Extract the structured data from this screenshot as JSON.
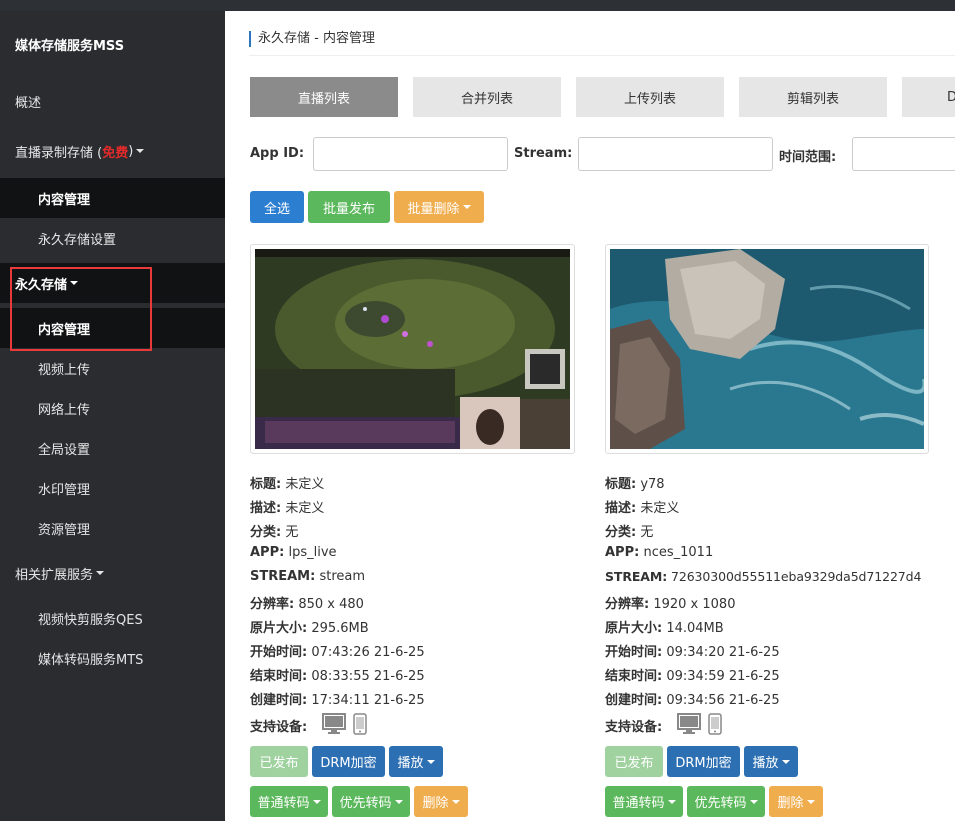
{
  "sidebar": {
    "title": "媒体存储服务MSS",
    "overview": "概述",
    "live_storage": "直播录制存储 (",
    "live_free": "免费",
    "live_close": ")",
    "content_mgmt_1": "内容管理",
    "perm_settings": "永久存储设置",
    "permanent": "永久存储",
    "content_mgmt_2": "内容管理",
    "video_upload": "视频上传",
    "net_upload": "网络上传",
    "global_settings": "全局设置",
    "watermark": "水印管理",
    "resources": "资源管理",
    "ext_services": "相关扩展服务",
    "qes": "视频快剪服务QES",
    "mts": "媒体转码服务MTS"
  },
  "breadcrumb": "永久存储 - 内容管理",
  "tabs": [
    "直播列表",
    "合并列表",
    "上传列表",
    "剪辑列表",
    "D"
  ],
  "filters": {
    "appid_label": "App ID:",
    "stream_label": "Stream:",
    "time_label": "时间范围:"
  },
  "actions": {
    "select_all": "全选",
    "batch_publish": "批量发布",
    "batch_delete": "批量删除"
  },
  "labels": {
    "title": "标题:",
    "desc": "描述:",
    "category": "分类:",
    "app": "APP:",
    "stream": "STREAM:",
    "resolution": "分辨率:",
    "size": "原片大小:",
    "start": "开始时间:",
    "end": "结束时间:",
    "created": "创建时间:",
    "devices": "支持设备:"
  },
  "card_buttons": {
    "published": "已发布",
    "drm": "DRM加密",
    "play": "播放",
    "normal_transcode": "普通转码",
    "priority_transcode": "优先转码",
    "delete": "删除"
  },
  "cards": [
    {
      "title": "未定义",
      "desc": "未定义",
      "category": "无",
      "app": "lps_live",
      "stream": "stream",
      "resolution": "850 x 480",
      "size": "295.6MB",
      "start": "07:43:26 21-6-25",
      "end": "08:33:55 21-6-25",
      "created": "17:34:11 21-6-25"
    },
    {
      "title": "y78",
      "desc": "未定义",
      "category": "无",
      "app": "nces_1011",
      "stream": "72630300d55511eba9329da5d71227d4",
      "resolution": "1920 x 1080",
      "size": "14.04MB",
      "start": "09:34:20 21-6-25",
      "end": "09:34:59 21-6-25",
      "created": "09:34:56 21-6-25"
    }
  ],
  "colors": {
    "sidebar_bg": "#2a2c30",
    "active_item_bg": "#111213",
    "accent_blue": "#2b7ed0",
    "green": "#5cb85c",
    "orange": "#f0ad4e",
    "highlight_red": "#e83a3a"
  }
}
